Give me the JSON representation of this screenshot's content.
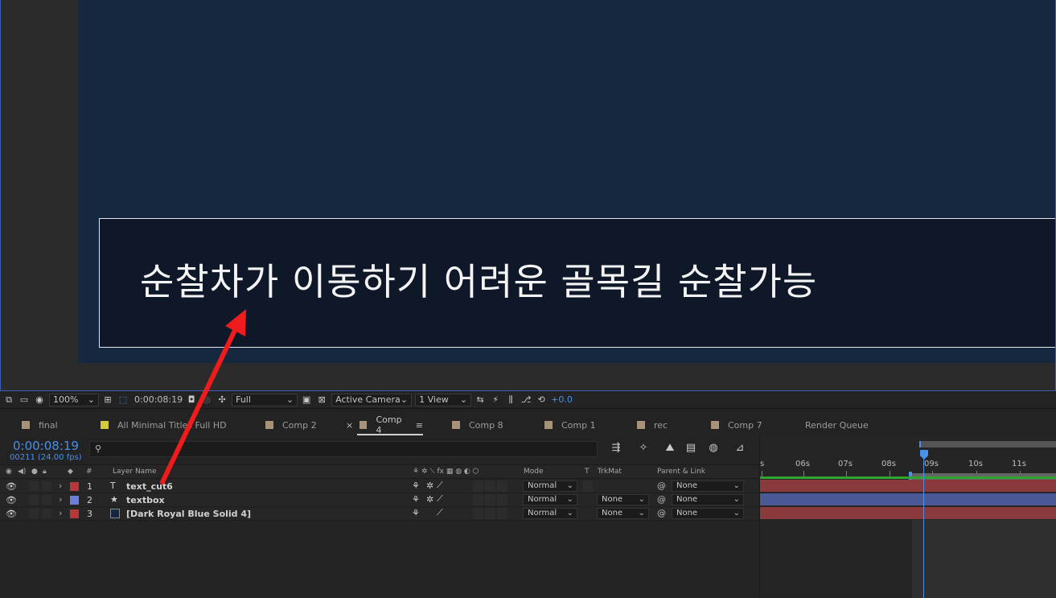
{
  "viewer": {
    "title_text": "순찰차가 이동하기 어려운 골목길 순찰가능"
  },
  "viewer_toolbar": {
    "zoom": "100%",
    "timecode": "0:00:08:19",
    "resolution": "Full",
    "camera": "Active Camera",
    "views": "1 View",
    "exposure": "+0.0"
  },
  "tabs": [
    {
      "label": "final",
      "color": "#a8927a"
    },
    {
      "label": "All Minimal Titles Full HD",
      "color": "#d4cc3c"
    },
    {
      "label": "Comp 2",
      "color": "#a8927a"
    },
    {
      "label": "Comp 4",
      "color": "#a8927a",
      "active": true,
      "close": "×",
      "menu": "≡"
    },
    {
      "label": "Comp 8",
      "color": "#a8927a"
    },
    {
      "label": "Comp 1",
      "color": "#a8927a"
    },
    {
      "label": "rec",
      "color": "#a8927a"
    },
    {
      "label": "Comp 7",
      "color": "#a8927a"
    },
    {
      "label": "Render Queue",
      "color": ""
    }
  ],
  "timeline": {
    "timecode": "0:00:08:19",
    "frames": "00211 (24.00 fps)",
    "search_placeholder": "",
    "columns": {
      "label": "#",
      "layer_name": "Layer Name",
      "mode": "Mode",
      "t": "T",
      "trkmat": "TrkMat",
      "parent": "Parent & Link"
    },
    "layers": [
      {
        "num": "1",
        "type_icon": "T",
        "name": "text_cut6",
        "color": "#b8383a",
        "mode": "Normal",
        "trkmat": "",
        "parent": "None"
      },
      {
        "num": "2",
        "type_icon": "★",
        "name": "textbox",
        "color": "#6a7ed8",
        "mode": "Normal",
        "trkmat": "None",
        "parent": "None"
      },
      {
        "num": "3",
        "type_icon": "",
        "name": "[Dark Royal Blue Solid 4]",
        "color": "#b8383a",
        "mode": "Normal",
        "trkmat": "None",
        "parent": "None"
      }
    ],
    "ruler": [
      "s",
      "06s",
      "07s",
      "08s",
      "09s",
      "10s",
      "11s"
    ],
    "bar_colors": [
      "#8a3a3c",
      "#4a5896",
      "#8a3a3c"
    ]
  },
  "colors": {
    "accent": "#4a8fe8",
    "canvas": "#162840",
    "title_box": "#0e1828",
    "arrow": "#ee1c1c"
  },
  "icons": {
    "eye": "eye-icon",
    "search": "search-icon",
    "chevron": "chevron-right-icon"
  }
}
